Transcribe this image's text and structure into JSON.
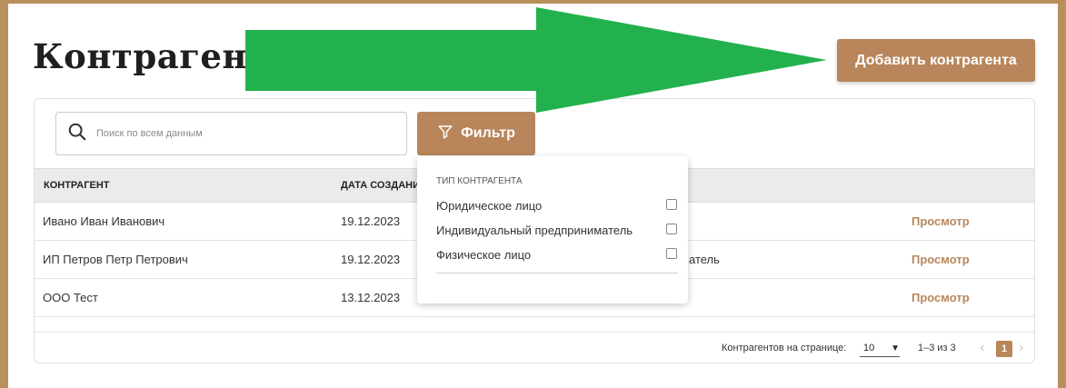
{
  "page_title": "Контрагенты",
  "add_button_label": "Добавить контрагента",
  "search": {
    "placeholder": "Поиск по всем данным"
  },
  "filter_button_label": "Фильтр",
  "table": {
    "columns": [
      "КОНТРАГЕНТ",
      "ДАТА СОЗДАНИ"
    ],
    "rows": [
      {
        "name": "Ивано Иван Иванович",
        "date": "19.12.2023",
        "partial": "",
        "action": "Просмотр"
      },
      {
        "name": "ИП Петров Петр Петрович",
        "date": "19.12.2023",
        "partial": "атель",
        "action": "Просмотр"
      },
      {
        "name": "ООО Тест",
        "date": "13.12.2023",
        "partial": "",
        "action": "Просмотр"
      }
    ]
  },
  "pagination": {
    "per_page_label": "Контрагентов на странице:",
    "per_page_value": "10",
    "range_text": "1–3 из 3",
    "current_page": "1",
    "prev_icon": "‹",
    "next_icon": "›"
  },
  "filter_dropdown": {
    "title": "ТИП КОНТРАГЕНТА",
    "options": [
      "Юридическое лицо",
      "Индивидуальный предприниматель",
      "Физическое лицо"
    ]
  },
  "colors": {
    "accent": "#b8865a",
    "frame": "#b8905c",
    "annotation_arrow": "#22b14c"
  },
  "icons": {
    "search": "search-icon",
    "filter": "funnel-icon",
    "dropdown_caret": "caret-down-icon",
    "annotation": "green-arrow-icon"
  }
}
